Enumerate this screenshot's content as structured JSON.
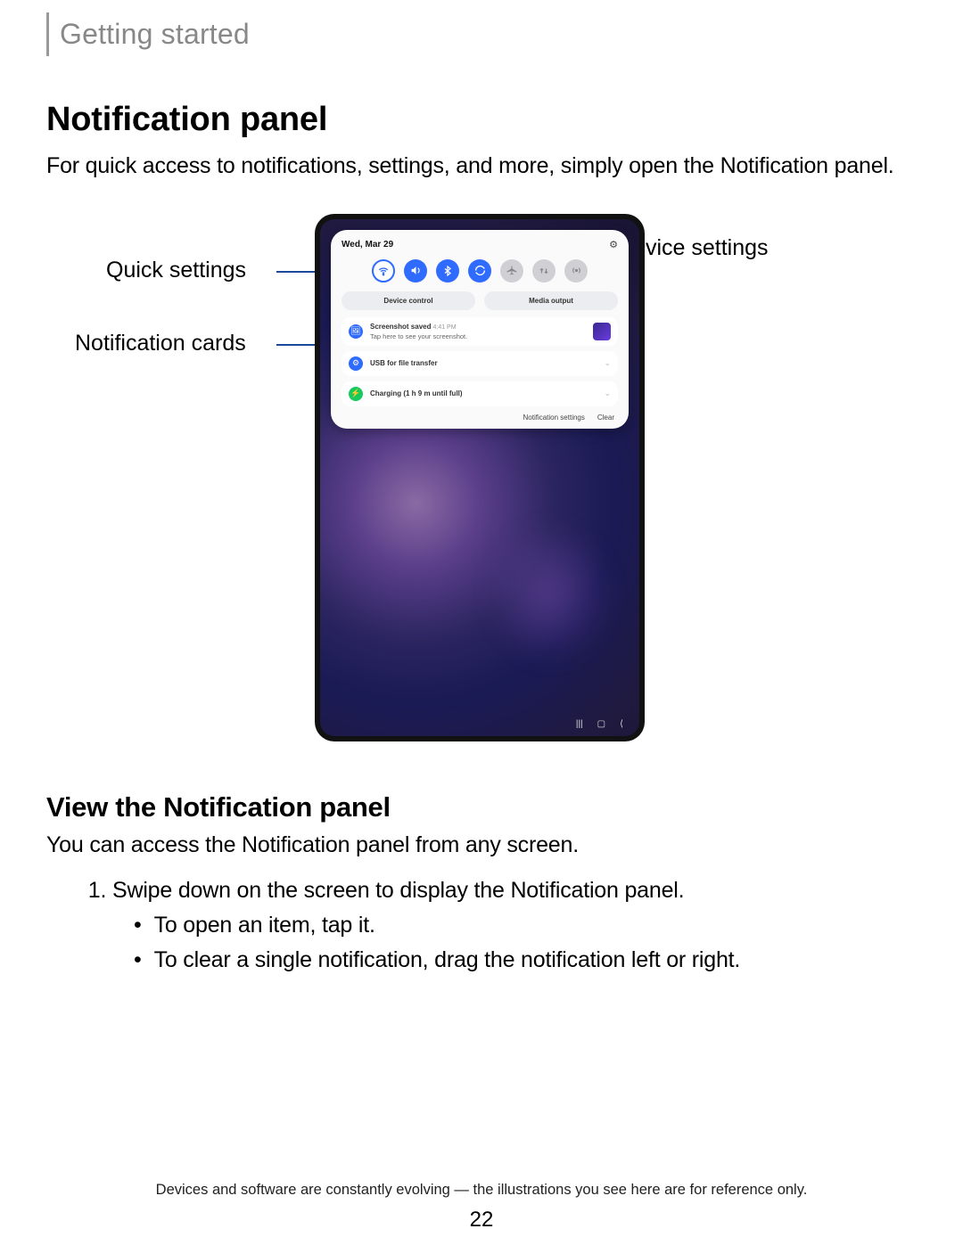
{
  "breadcrumb": "Getting started",
  "title": "Notification panel",
  "intro": "For quick access to notifications, settings, and more, simply open the Notification panel.",
  "callouts": {
    "quick_settings": "Quick settings",
    "notification_cards": "Notification cards",
    "device_settings": "Device settings"
  },
  "panel": {
    "date": "Wed, Mar 29",
    "pills": {
      "device_control": "Device control",
      "media_output": "Media output"
    },
    "cards": [
      {
        "icon_color": "#2F6BFF",
        "glyph": "🖼",
        "title": "Screenshot saved",
        "time": "4:41 PM",
        "sub": "Tap here to see your screenshot.",
        "thumb": true
      },
      {
        "icon_color": "#2F6BFF",
        "glyph": "⚙",
        "title": "USB for file transfer",
        "time": "",
        "sub": "",
        "chev": true
      },
      {
        "icon_color": "#18C95E",
        "glyph": "⚡",
        "title": "Charging (1 h 9 m until full)",
        "time": "",
        "sub": "",
        "chev": true
      }
    ],
    "actions": {
      "settings": "Notification settings",
      "clear": "Clear"
    }
  },
  "subhead": "View the Notification panel",
  "subintro": "You can access the Notification panel from any screen.",
  "steps": {
    "s1": "Swipe down on the screen to display the Notification panel.",
    "s1b1": "To open an item, tap it.",
    "s1b2": "To clear a single notification, drag the notification left or right."
  },
  "footer": "Devices and software are constantly evolving — the illustrations you see here are for reference only.",
  "page_number": "22"
}
